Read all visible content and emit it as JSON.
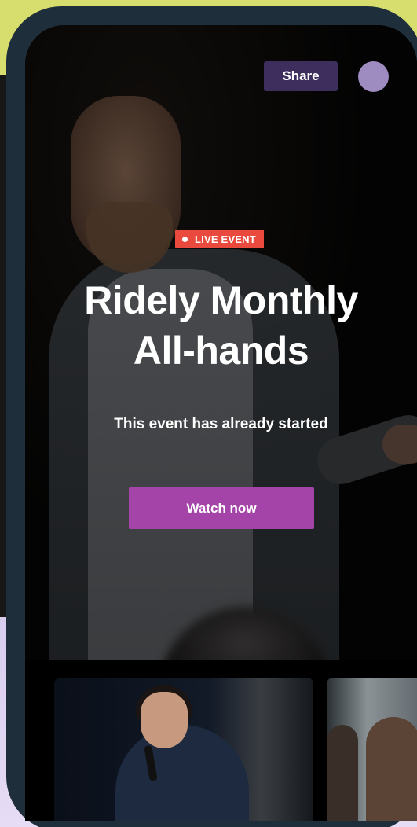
{
  "header": {
    "share_label": "Share",
    "avatar_color": "#9e8cc0"
  },
  "event": {
    "badge_label": "LIVE EVENT",
    "badge_color": "#ea4a3d",
    "title_line1": "Ridely Monthly",
    "title_line2": "All-hands",
    "status": "This event has already started",
    "cta_label": "Watch now",
    "cta_color": "#a444a8"
  },
  "thumbnails": [
    {
      "icon": "event-thumbnail-image"
    },
    {
      "icon": "event-thumbnail-image"
    }
  ],
  "colors": {
    "backdrop_top": "#d8de6e",
    "backdrop_bottom": "#d9cdee",
    "phone_frame": "#1e2f3b",
    "share_button": "#3d2e5e"
  }
}
